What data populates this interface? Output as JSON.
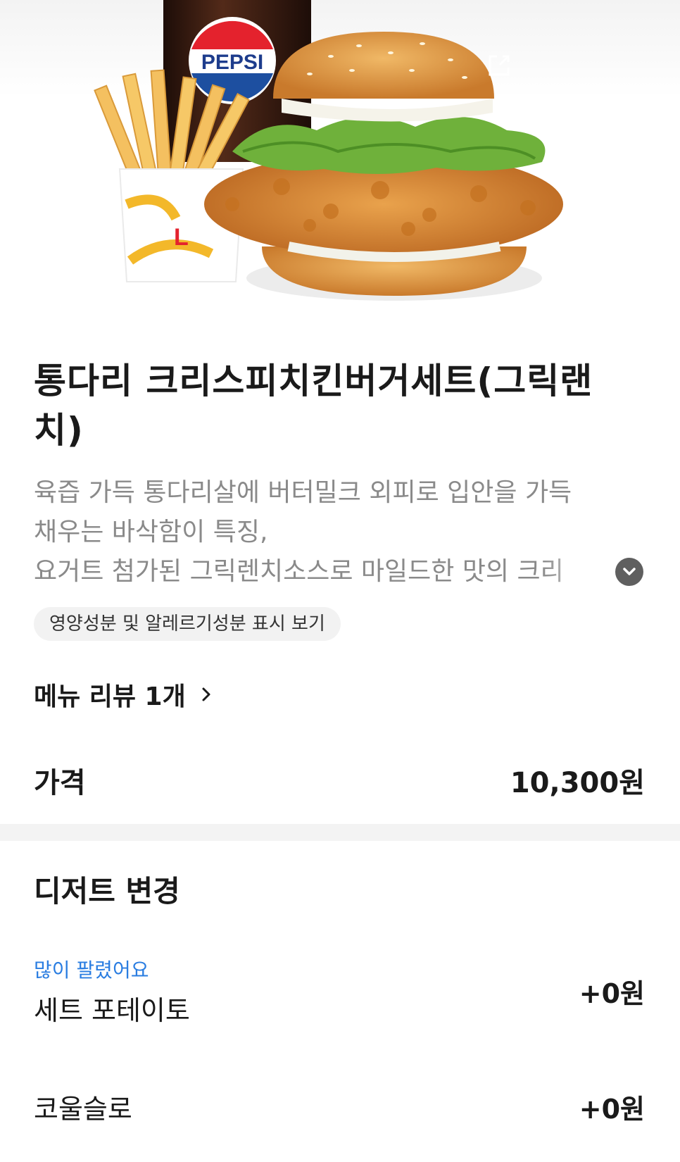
{
  "product": {
    "title": "통다리 크리스피치킨버거세트(그릭랜치)",
    "description_lines": [
      "육즙 가득 통다리살에 버터밀크 외피로 입안을 가득",
      "채우는 바삭함이 특징,",
      "요거트 첨가된 그릭렌치소스로 마일드한 맛의 크리"
    ],
    "nutrition_label": "영양성분 및 알레르기성분 표시 보기",
    "review_label": "메뉴 리뷰 1개",
    "price_label": "가격",
    "price_value": "10,300원"
  },
  "image": {
    "cup_logo": "PEPSI",
    "fries_logo": "L"
  },
  "section": {
    "title": "디저트 변경",
    "options": [
      {
        "badge": "많이 팔렸어요",
        "name": "세트 포테이토",
        "price": "+0원"
      },
      {
        "badge": "",
        "name": "코울슬로",
        "price": "+0원"
      }
    ]
  },
  "colors": {
    "accent_blue": "#2a7de1",
    "text_gray": "#8a8a8a",
    "divider": "#f3f3f3"
  },
  "icons": [
    "share-icon",
    "chevron-down-icon",
    "chevron-right-icon"
  ]
}
